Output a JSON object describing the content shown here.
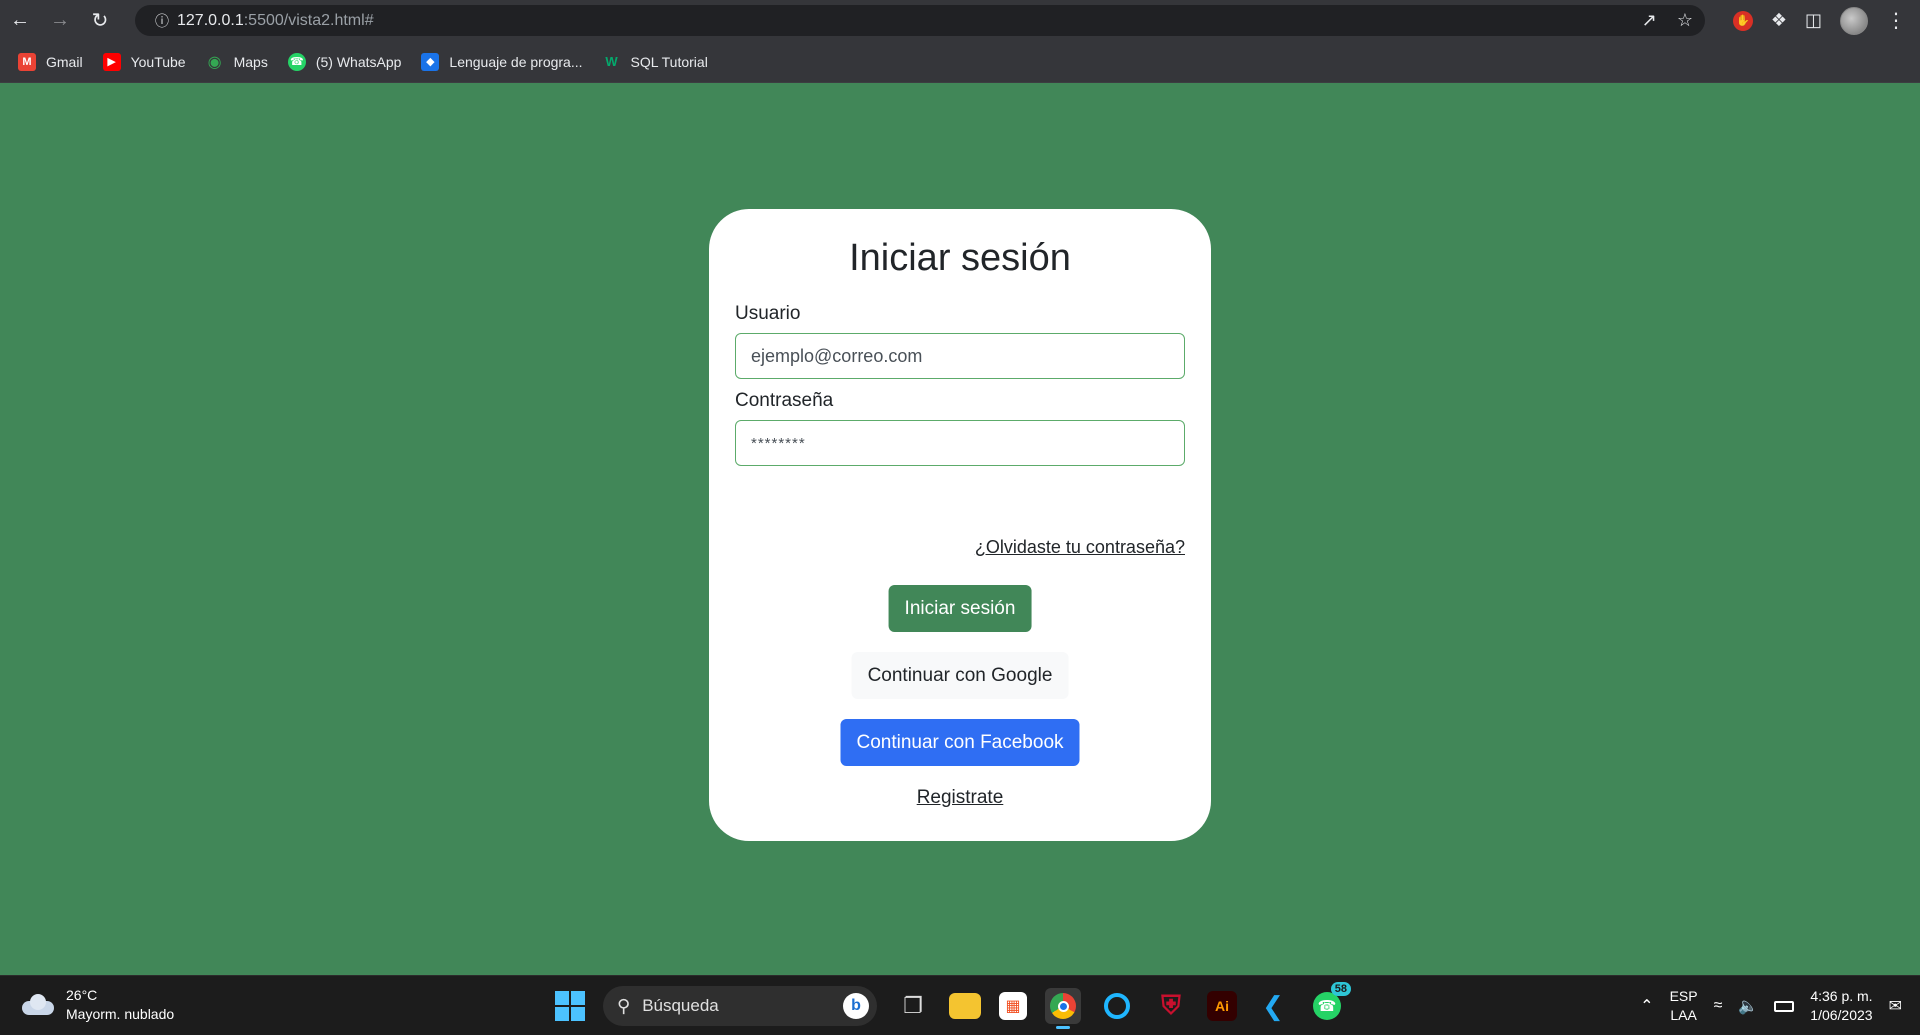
{
  "browser": {
    "url_host": "127.0.0.1",
    "url_rest": ":5500/vista2.html#",
    "bookmarks": [
      {
        "label": "Gmail",
        "icon": "gmail-icon",
        "color": "#ea4335"
      },
      {
        "label": "YouTube",
        "icon": "youtube-icon",
        "color": "#ff0000"
      },
      {
        "label": "Maps",
        "icon": "maps-icon",
        "color": "#34a853"
      },
      {
        "label": "(5) WhatsApp",
        "icon": "whatsapp-icon",
        "color": "#25d366"
      },
      {
        "label": "Lenguaje de progra...",
        "icon": "bookmark-site-icon",
        "color": "#1a73e8"
      },
      {
        "label": "SQL Tutorial",
        "icon": "w3schools-icon",
        "color": "#04aa6d"
      }
    ]
  },
  "login": {
    "title": "Iniciar sesión",
    "user_label": "Usuario",
    "user_value": "ejemplo@correo.com",
    "password_label": "Contraseña",
    "password_value": "********",
    "forgot_link": "¿Olvidaste tu contraseña?",
    "login_button": "Iniciar sesión",
    "google_button": "Continuar con Google",
    "facebook_button": "Continuar con Facebook",
    "register_link": "Registrate"
  },
  "colors": {
    "page_background": "#418758",
    "login_button": "#418758",
    "facebook_button": "#2f6ef3"
  },
  "taskbar": {
    "weather_temp": "26°C",
    "weather_desc": "Mayorm. nublado",
    "search_placeholder": "Búsqueda",
    "whatsapp_badge": "58",
    "lang_line1": "ESP",
    "lang_line2": "LAA",
    "time": "4:36 p. m.",
    "date": "1/06/2023"
  }
}
